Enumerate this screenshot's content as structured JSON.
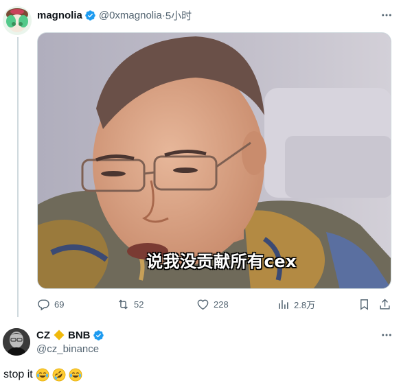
{
  "tweet1": {
    "name": "magnolia",
    "handle": "@0xmagnolia",
    "sep": " · ",
    "time": "5小时",
    "subtitle": "说我没贡献所有cex",
    "replies": "69",
    "retweets": "52",
    "likes": "228",
    "views": "2.8万"
  },
  "tweet2": {
    "name_part1": "CZ",
    "name_part2": "BNB",
    "handle": "@cz_binance",
    "text": "stop it"
  },
  "icons": {
    "verified": "verified-badge-icon",
    "more": "more-icon",
    "reply": "reply-icon",
    "retweet": "retweet-icon",
    "like": "heart-icon",
    "views": "views-icon",
    "bookmark": "bookmark-icon",
    "share": "share-icon"
  },
  "colors": {
    "verified": "#1d9bf0",
    "binance": "#f0b90b",
    "muted": "#536471"
  }
}
